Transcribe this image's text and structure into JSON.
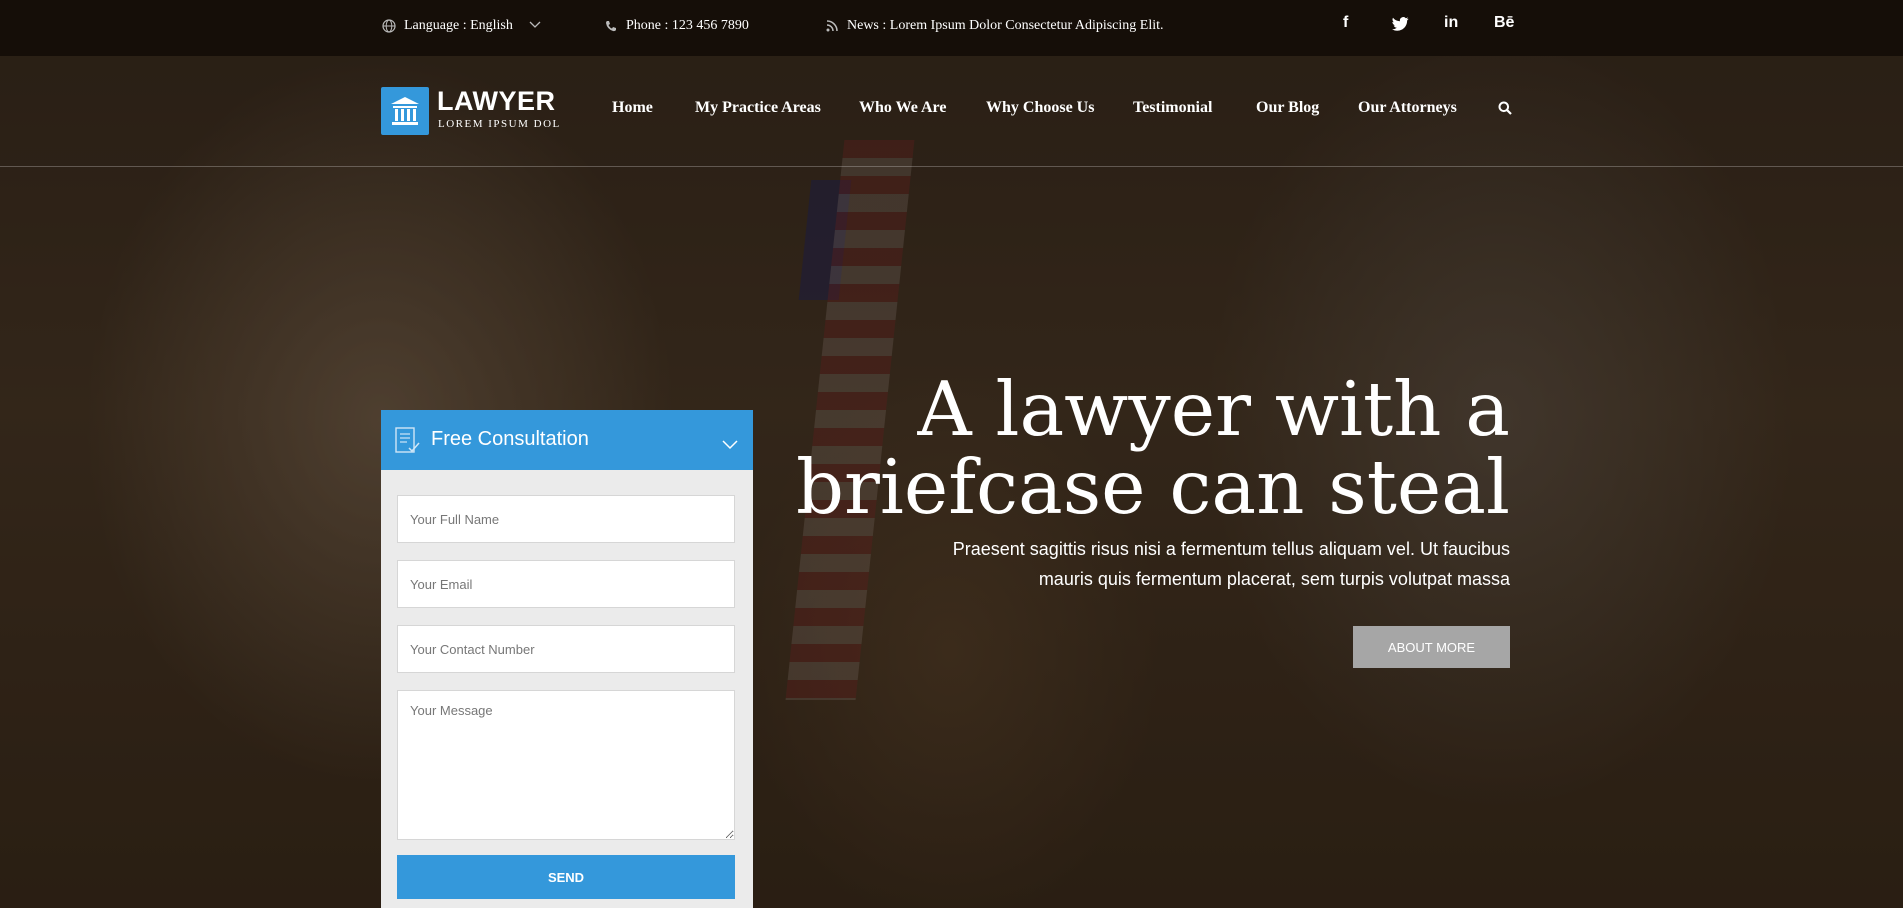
{
  "colors": {
    "accent": "#3498db",
    "topbar_bg": "#150e08",
    "button_gray": "#a6a6a6"
  },
  "topbar": {
    "language": "Language : English",
    "phone": "Phone : 123 456 7890",
    "news": "News : Lorem Ipsum Dolor Consectetur Adipiscing Elit.",
    "social": [
      {
        "label": "f",
        "icon": "facebook-icon"
      },
      {
        "label": "twitter",
        "icon": "twitter-icon"
      },
      {
        "label": "in",
        "icon": "linkedin-icon"
      },
      {
        "label": "Bē",
        "icon": "behance-icon"
      }
    ]
  },
  "logo": {
    "title": "LAWYER",
    "subtitle": "LOREM IPSUM DOL",
    "icon": "courthouse-icon"
  },
  "nav": {
    "items": [
      "Home",
      "My Practice Areas",
      "Who We Are",
      "Why Choose Us",
      "Testimonial",
      "Our Blog",
      "Our Attorneys"
    ],
    "search_icon": "search-icon"
  },
  "hero": {
    "title_line1": "A lawyer with a",
    "title_line2": "briefcase can steal",
    "subtitle_line1": "Praesent sagittis risus nisi a fermentum tellus aliquam vel. Ut faucibus",
    "subtitle_line2": "mauris quis fermentum placerat, sem turpis volutpat massa",
    "button": "ABOUT MORE"
  },
  "form": {
    "title": "Free Consultation",
    "fields": {
      "name": "Your Full Name",
      "email": "Your Email",
      "contact": "Your Contact Number",
      "message": "Your Message"
    },
    "submit": "SEND"
  }
}
